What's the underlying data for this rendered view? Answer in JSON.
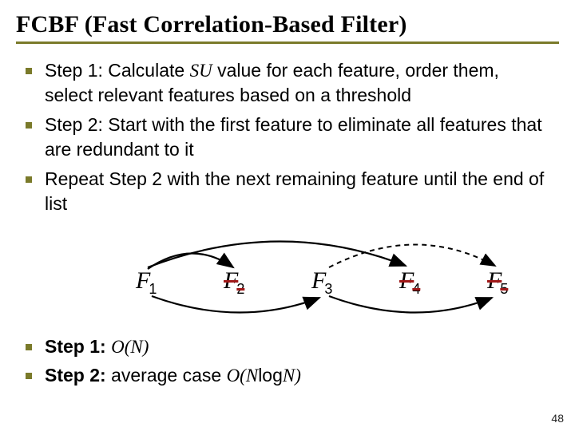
{
  "title": "FCBF (Fast Correlation-Based Filter)",
  "bullets": {
    "step1_pre": "Step 1: Calculate ",
    "step1_su": "SU",
    "step1_post": " value for each feature, order them, select relevant features based on a threshold",
    "step2": "Step 2: Start with the first feature to eliminate all features that are redundant to it",
    "repeat": "Repeat Step 2 with the next remaining feature until the end of list"
  },
  "diagram": {
    "f_symbol": "F",
    "nodes": [
      {
        "sub": "1",
        "struck": false
      },
      {
        "sub": "2",
        "struck": true
      },
      {
        "sub": "3",
        "struck": false
      },
      {
        "sub": "4",
        "struck": true
      },
      {
        "sub": "5",
        "struck": true
      }
    ]
  },
  "complexity": {
    "step1_label": "Step 1: ",
    "step1_o": "O(N)",
    "step2_label": "Step 2: ",
    "step2_text": "average case ",
    "step2_o": "O(N",
    "step2_log": "log",
    "step2_tail": "N)"
  },
  "page_number": "48"
}
